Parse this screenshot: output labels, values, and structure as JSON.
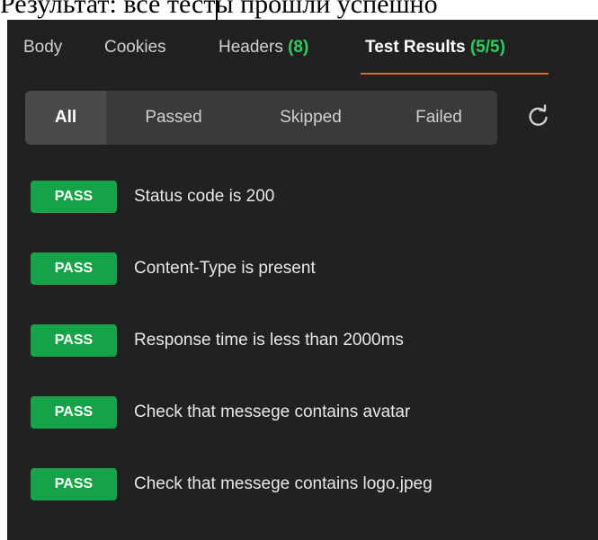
{
  "caption": {
    "text": "Результат: все тесты прошли успешно"
  },
  "tabs": [
    {
      "label": "Body",
      "count": ""
    },
    {
      "label": "Cookies",
      "count": ""
    },
    {
      "label": "Headers",
      "count": "(8)"
    },
    {
      "label": "Test Results",
      "count": "(5/5)"
    }
  ],
  "active_tab": "Test Results",
  "filters": [
    {
      "label": "All"
    },
    {
      "label": "Passed"
    },
    {
      "label": "Skipped"
    },
    {
      "label": "Failed"
    }
  ],
  "active_filter": "All",
  "refresh": {
    "icon": "refresh-icon"
  },
  "results": [
    {
      "status": "PASS",
      "name": "Status code is 200"
    },
    {
      "status": "PASS",
      "name": "Content-Type is present"
    },
    {
      "status": "PASS",
      "name": "Response time is less than 2000ms"
    },
    {
      "status": "PASS",
      "name": "Check that messege contains avatar"
    },
    {
      "status": "PASS",
      "name": "Check that messege contains logo.jpeg"
    }
  ],
  "colors": {
    "panel_background": "#212121",
    "filter_bar_background": "#3a3a3a",
    "active_filter_background": "#4a4a4a",
    "pass_badge": "#16a348",
    "count_green": "#2ecc5c",
    "active_tab_underline": "#e0662a"
  }
}
